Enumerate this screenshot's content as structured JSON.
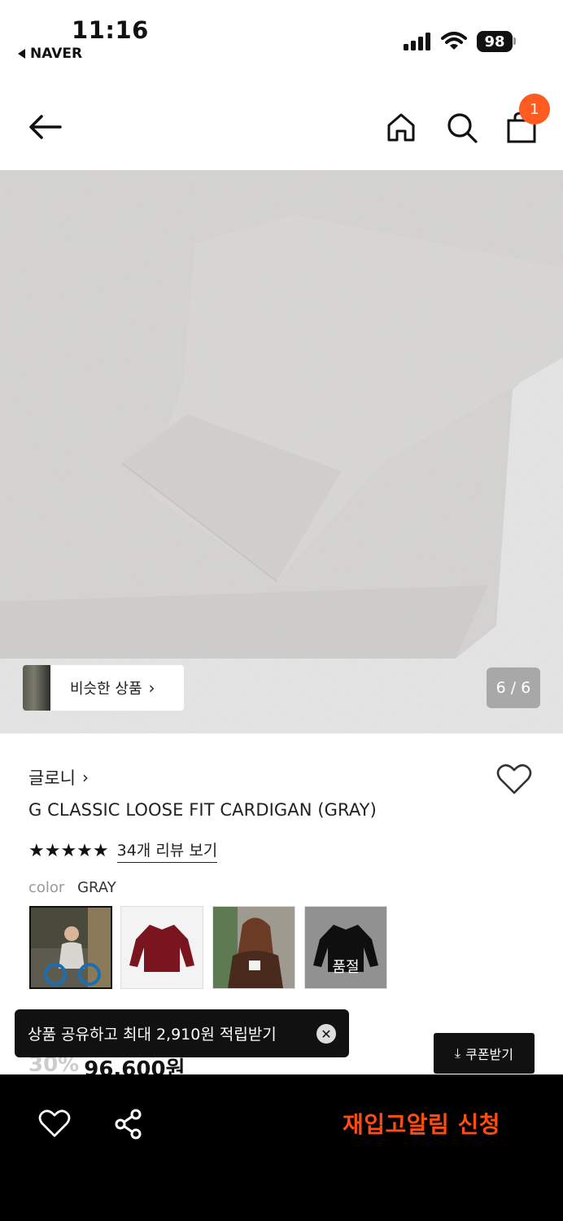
{
  "status_bar": {
    "time": "11:16",
    "back_app": "NAVER",
    "battery": "98"
  },
  "nav": {
    "cart_count": "1"
  },
  "gallery": {
    "similar_label": "비슷한 상품",
    "page_indicator": "6 / 6"
  },
  "product": {
    "brand": "글로니",
    "title": "G CLASSIC LOOSE FIT CARDIGAN (GRAY)",
    "stars": "★★★★★",
    "review_link": "34개 리뷰 보기",
    "color_label": "color",
    "color_value": "GRAY",
    "swatches": [
      {
        "name": "gray",
        "sold_out": false
      },
      {
        "name": "burgundy",
        "sold_out": false
      },
      {
        "name": "brown",
        "sold_out": false
      },
      {
        "name": "black",
        "sold_out": true,
        "label": "품절"
      }
    ],
    "discount": "30%",
    "price": "96,600원"
  },
  "toast": {
    "text": "상품 공유하고 최대 2,910원 적립받기"
  },
  "coupon_button": {
    "label": "쿠폰받기"
  },
  "bottom_bar": {
    "restock_label": "재입고알림 신청"
  },
  "colors": {
    "accent": "#ff5a1f",
    "restock": "#ff4d12",
    "bar_bg": "#000000"
  }
}
